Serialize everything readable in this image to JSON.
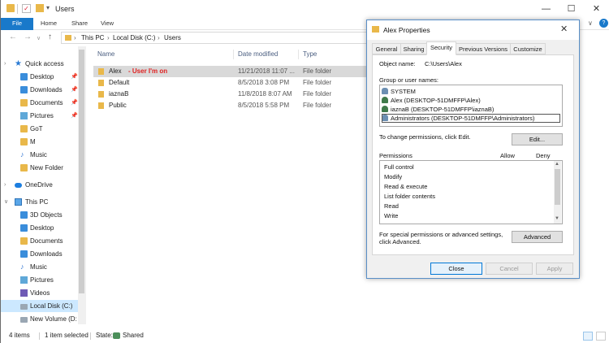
{
  "explorer": {
    "title": "Users",
    "window_buttons": {
      "minimize": "—",
      "maximize": "☐",
      "close": "✕"
    },
    "ribbon": {
      "tabs": [
        "File",
        "Home",
        "Share",
        "View"
      ]
    },
    "nav": {
      "back": "←",
      "forward": "→",
      "recent": "∨",
      "up": "↑"
    },
    "address": {
      "segments": [
        "This PC",
        "Local Disk (C:)",
        "Users"
      ],
      "chevron": "›"
    },
    "navpane": {
      "items": [
        {
          "label": "Quick access",
          "icon": "star-icon"
        },
        {
          "label": "Desktop",
          "icon": "folder-icon",
          "pinned": true
        },
        {
          "label": "Downloads",
          "icon": "folder-icon",
          "pinned": true
        },
        {
          "label": "Documents",
          "icon": "folder-icon",
          "pinned": true
        },
        {
          "label": "Pictures",
          "icon": "folder-icon",
          "pinned": true
        },
        {
          "label": "GoT",
          "icon": "folder-icon"
        },
        {
          "label": "M",
          "icon": "folder-icon"
        },
        {
          "label": "Music",
          "icon": "music-icon"
        },
        {
          "label": "New Folder",
          "icon": "folder-icon"
        },
        {
          "label": "OneDrive",
          "icon": "cloud-icon"
        },
        {
          "label": "This PC",
          "icon": "pc-icon"
        },
        {
          "label": "3D Objects",
          "icon": "folder-icon"
        },
        {
          "label": "Desktop",
          "icon": "folder-icon"
        },
        {
          "label": "Documents",
          "icon": "folder-icon"
        },
        {
          "label": "Downloads",
          "icon": "folder-icon"
        },
        {
          "label": "Music",
          "icon": "music-icon"
        },
        {
          "label": "Pictures",
          "icon": "pictures-icon"
        },
        {
          "label": "Videos",
          "icon": "videos-icon"
        },
        {
          "label": "Local Disk (C:)",
          "icon": "drive-icon",
          "selected": true
        },
        {
          "label": "New Volume (D:",
          "icon": "drive-icon"
        }
      ],
      "pin_glyph": "📌"
    },
    "columns": {
      "name": "Name",
      "date": "Date modified",
      "type": "Type"
    },
    "files": [
      {
        "name": "Alex",
        "note": "- User I'm on",
        "date": "11/21/2018 11:07 ...",
        "type": "File folder",
        "selected": true
      },
      {
        "name": "Default",
        "note": "",
        "date": "8/5/2018 3:08 PM",
        "type": "File folder"
      },
      {
        "name": "iaznaB",
        "note": "",
        "date": "11/8/2018 8:07 AM",
        "type": "File folder"
      },
      {
        "name": "Public",
        "note": "",
        "date": "8/5/2018 5:58 PM",
        "type": "File folder"
      }
    ],
    "status": {
      "items": "4 items",
      "selected": "1 item selected",
      "state_label": "State:",
      "state_value": "Shared"
    }
  },
  "dialog": {
    "title": "Alex Properties",
    "close": "✕",
    "tabs": [
      "General",
      "Sharing",
      "Security",
      "Previous Versions",
      "Customize"
    ],
    "active_tab": "Security",
    "object_name_label": "Object name:",
    "object_name_value": "C:\\Users\\Alex",
    "group_label": "Group or user names:",
    "groups": [
      {
        "name": "SYSTEM",
        "icon": "users-icon"
      },
      {
        "name": "Alex (DESKTOP-51DMFFP\\Alex)",
        "icon": "user-icon"
      },
      {
        "name": "iaznaB (DESKTOP-51DMFFP\\iaznaB)",
        "icon": "user-icon"
      },
      {
        "name": "Administrators (DESKTOP-51DMFFP\\Administrators)",
        "icon": "users-icon",
        "selected": true
      }
    ],
    "change_perm_text": "To change permissions, click Edit.",
    "edit_button": "Edit...",
    "permissions_label": "Permissions",
    "allow_label": "Allow",
    "deny_label": "Deny",
    "permissions": [
      "Full control",
      "Modify",
      "Read & execute",
      "List folder contents",
      "Read",
      "Write"
    ],
    "special_text_1": "For special permissions or advanced settings,",
    "special_text_2": "click Advanced.",
    "advanced_button": "Advanced",
    "buttons": {
      "close": "Close",
      "cancel": "Cancel",
      "apply": "Apply"
    }
  }
}
